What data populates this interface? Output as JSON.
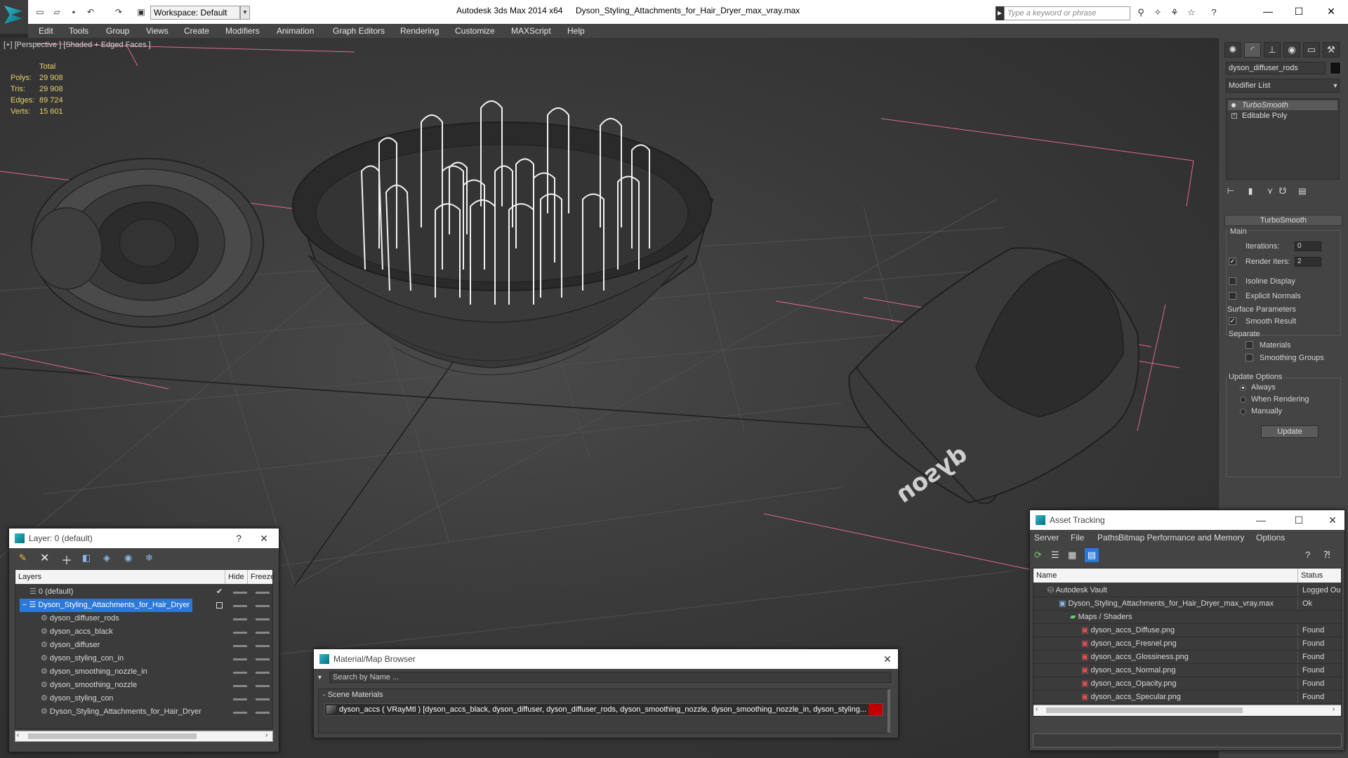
{
  "titlebar": {
    "workspace_label": "Workspace: Default",
    "app_title": "Autodesk 3ds Max  2014 x64",
    "file_title": "Dyson_Styling_Attachments_for_Hair_Dryer_max_vray.max",
    "search_placeholder": "Type a keyword or phrase",
    "minimize": "—",
    "maximize": "☐",
    "close": "✕"
  },
  "menu": [
    "Edit",
    "Tools",
    "Group",
    "Views",
    "Create",
    "Modifiers",
    "Animation",
    "Graph Editors",
    "Rendering",
    "Customize",
    "MAXScript",
    "Help"
  ],
  "viewport": {
    "label": "[+] [Perspective ] [Shaded + Edged Faces ]",
    "stats": {
      "header": "Total",
      "rows": [
        {
          "label": "Polys:",
          "value": "29 908"
        },
        {
          "label": "Tris:",
          "value": "29 908"
        },
        {
          "label": "Edges:",
          "value": "89 724"
        },
        {
          "label": "Verts:",
          "value": "15 601"
        }
      ]
    },
    "brand_text": "dyson"
  },
  "command_panel": {
    "object_name": "dyson_diffuser_rods",
    "modifier_list": "Modifier List",
    "stack": [
      "TurboSmooth",
      "Editable Poly"
    ],
    "rollout_title": "TurboSmooth",
    "main_group": "Main",
    "iterations_label": "Iterations:",
    "iterations_value": "0",
    "render_iters_label": "Render Iters:",
    "render_iters_value": "2",
    "isoline_display": "Isoline Display",
    "explicit_normals": "Explicit Normals",
    "surface_params": "Surface Parameters",
    "smooth_result": "Smooth Result",
    "separate": "Separate",
    "materials": "Materials",
    "smoothing_groups": "Smoothing Groups",
    "update_options": "Update Options",
    "always": "Always",
    "when_rendering": "When Rendering",
    "manually": "Manually",
    "update_button": "Update"
  },
  "layer_window": {
    "title": "Layer: 0 (default)",
    "help": "?",
    "close": "✕",
    "columns": [
      "Layers",
      "Hide",
      "Freeze"
    ],
    "rows": [
      {
        "name": "0 (default)",
        "indent": 0
      },
      {
        "name": "Dyson_Styling_Attachments_for_Hair_Dryer",
        "indent": 0
      },
      {
        "name": "dyson_diffuser_rods",
        "indent": 1
      },
      {
        "name": "dyson_accs_black",
        "indent": 1
      },
      {
        "name": "dyson_diffuser",
        "indent": 1
      },
      {
        "name": "dyson_styling_con_in",
        "indent": 1
      },
      {
        "name": "dyson_smoothing_nozzle_in",
        "indent": 1
      },
      {
        "name": "dyson_smoothing_nozzle",
        "indent": 1
      },
      {
        "name": "dyson_styling_con",
        "indent": 1
      },
      {
        "name": "Dyson_Styling_Attachments_for_Hair_Dryer",
        "indent": 1
      }
    ]
  },
  "material_browser": {
    "title": "Material/Map Browser",
    "close": "✕",
    "search_placeholder": "Search by Name ...",
    "section": "- Scene Materials",
    "material_entry": "dyson_accs ( VRayMtl ) [dyson_accs_black, dyson_diffuser, dyson_diffuser_rods, dyson_smoothing_nozzle, dyson_smoothing_nozzle_in, dyson_styling..."
  },
  "asset_tracking": {
    "title": "Asset Tracking",
    "minimize": "—",
    "maximize": "☐",
    "close": "✕",
    "menu": [
      "Server",
      "File",
      "Paths",
      "Bitmap Performance and Memory",
      "Options"
    ],
    "columns": [
      "Name",
      "Status"
    ],
    "rows": [
      {
        "name": "Autodesk Vault",
        "status": "Logged Ou",
        "indent": 1
      },
      {
        "name": "Dyson_Styling_Attachments_for_Hair_Dryer_max_vray.max",
        "status": "Ok",
        "indent": 2
      },
      {
        "name": "Maps / Shaders",
        "status": "",
        "indent": 3
      },
      {
        "name": "dyson_accs_Diffuse.png",
        "status": "Found",
        "indent": 4
      },
      {
        "name": "dyson_accs_Fresnel.png",
        "status": "Found",
        "indent": 4
      },
      {
        "name": "dyson_accs_Glossiness.png",
        "status": "Found",
        "indent": 4
      },
      {
        "name": "dyson_accs_Normal.png",
        "status": "Found",
        "indent": 4
      },
      {
        "name": "dyson_accs_Opacity.png",
        "status": "Found",
        "indent": 4
      },
      {
        "name": "dyson_accs_Specular.png",
        "status": "Found",
        "indent": 4
      }
    ]
  },
  "colors": {
    "accent": "#2b78d8",
    "stats": "#e8d06a",
    "panel": "#444444",
    "viewport_bg": "#3a3a3a"
  }
}
